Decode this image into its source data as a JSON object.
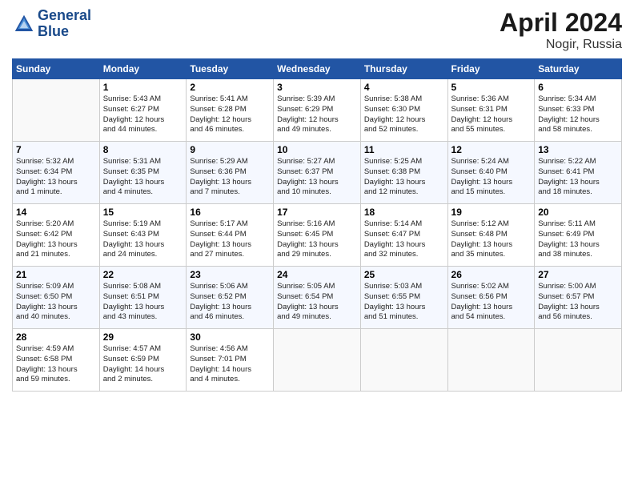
{
  "header": {
    "logo_line1": "General",
    "logo_line2": "Blue",
    "month": "April 2024",
    "location": "Nogir, Russia"
  },
  "columns": [
    "Sunday",
    "Monday",
    "Tuesday",
    "Wednesday",
    "Thursday",
    "Friday",
    "Saturday"
  ],
  "weeks": [
    [
      {
        "day": "",
        "info": ""
      },
      {
        "day": "1",
        "info": "Sunrise: 5:43 AM\nSunset: 6:27 PM\nDaylight: 12 hours\nand 44 minutes."
      },
      {
        "day": "2",
        "info": "Sunrise: 5:41 AM\nSunset: 6:28 PM\nDaylight: 12 hours\nand 46 minutes."
      },
      {
        "day": "3",
        "info": "Sunrise: 5:39 AM\nSunset: 6:29 PM\nDaylight: 12 hours\nand 49 minutes."
      },
      {
        "day": "4",
        "info": "Sunrise: 5:38 AM\nSunset: 6:30 PM\nDaylight: 12 hours\nand 52 minutes."
      },
      {
        "day": "5",
        "info": "Sunrise: 5:36 AM\nSunset: 6:31 PM\nDaylight: 12 hours\nand 55 minutes."
      },
      {
        "day": "6",
        "info": "Sunrise: 5:34 AM\nSunset: 6:33 PM\nDaylight: 12 hours\nand 58 minutes."
      }
    ],
    [
      {
        "day": "7",
        "info": "Sunrise: 5:32 AM\nSunset: 6:34 PM\nDaylight: 13 hours\nand 1 minute."
      },
      {
        "day": "8",
        "info": "Sunrise: 5:31 AM\nSunset: 6:35 PM\nDaylight: 13 hours\nand 4 minutes."
      },
      {
        "day": "9",
        "info": "Sunrise: 5:29 AM\nSunset: 6:36 PM\nDaylight: 13 hours\nand 7 minutes."
      },
      {
        "day": "10",
        "info": "Sunrise: 5:27 AM\nSunset: 6:37 PM\nDaylight: 13 hours\nand 10 minutes."
      },
      {
        "day": "11",
        "info": "Sunrise: 5:25 AM\nSunset: 6:38 PM\nDaylight: 13 hours\nand 12 minutes."
      },
      {
        "day": "12",
        "info": "Sunrise: 5:24 AM\nSunset: 6:40 PM\nDaylight: 13 hours\nand 15 minutes."
      },
      {
        "day": "13",
        "info": "Sunrise: 5:22 AM\nSunset: 6:41 PM\nDaylight: 13 hours\nand 18 minutes."
      }
    ],
    [
      {
        "day": "14",
        "info": "Sunrise: 5:20 AM\nSunset: 6:42 PM\nDaylight: 13 hours\nand 21 minutes."
      },
      {
        "day": "15",
        "info": "Sunrise: 5:19 AM\nSunset: 6:43 PM\nDaylight: 13 hours\nand 24 minutes."
      },
      {
        "day": "16",
        "info": "Sunrise: 5:17 AM\nSunset: 6:44 PM\nDaylight: 13 hours\nand 27 minutes."
      },
      {
        "day": "17",
        "info": "Sunrise: 5:16 AM\nSunset: 6:45 PM\nDaylight: 13 hours\nand 29 minutes."
      },
      {
        "day": "18",
        "info": "Sunrise: 5:14 AM\nSunset: 6:47 PM\nDaylight: 13 hours\nand 32 minutes."
      },
      {
        "day": "19",
        "info": "Sunrise: 5:12 AM\nSunset: 6:48 PM\nDaylight: 13 hours\nand 35 minutes."
      },
      {
        "day": "20",
        "info": "Sunrise: 5:11 AM\nSunset: 6:49 PM\nDaylight: 13 hours\nand 38 minutes."
      }
    ],
    [
      {
        "day": "21",
        "info": "Sunrise: 5:09 AM\nSunset: 6:50 PM\nDaylight: 13 hours\nand 40 minutes."
      },
      {
        "day": "22",
        "info": "Sunrise: 5:08 AM\nSunset: 6:51 PM\nDaylight: 13 hours\nand 43 minutes."
      },
      {
        "day": "23",
        "info": "Sunrise: 5:06 AM\nSunset: 6:52 PM\nDaylight: 13 hours\nand 46 minutes."
      },
      {
        "day": "24",
        "info": "Sunrise: 5:05 AM\nSunset: 6:54 PM\nDaylight: 13 hours\nand 49 minutes."
      },
      {
        "day": "25",
        "info": "Sunrise: 5:03 AM\nSunset: 6:55 PM\nDaylight: 13 hours\nand 51 minutes."
      },
      {
        "day": "26",
        "info": "Sunrise: 5:02 AM\nSunset: 6:56 PM\nDaylight: 13 hours\nand 54 minutes."
      },
      {
        "day": "27",
        "info": "Sunrise: 5:00 AM\nSunset: 6:57 PM\nDaylight: 13 hours\nand 56 minutes."
      }
    ],
    [
      {
        "day": "28",
        "info": "Sunrise: 4:59 AM\nSunset: 6:58 PM\nDaylight: 13 hours\nand 59 minutes."
      },
      {
        "day": "29",
        "info": "Sunrise: 4:57 AM\nSunset: 6:59 PM\nDaylight: 14 hours\nand 2 minutes."
      },
      {
        "day": "30",
        "info": "Sunrise: 4:56 AM\nSunset: 7:01 PM\nDaylight: 14 hours\nand 4 minutes."
      },
      {
        "day": "",
        "info": ""
      },
      {
        "day": "",
        "info": ""
      },
      {
        "day": "",
        "info": ""
      },
      {
        "day": "",
        "info": ""
      }
    ]
  ]
}
